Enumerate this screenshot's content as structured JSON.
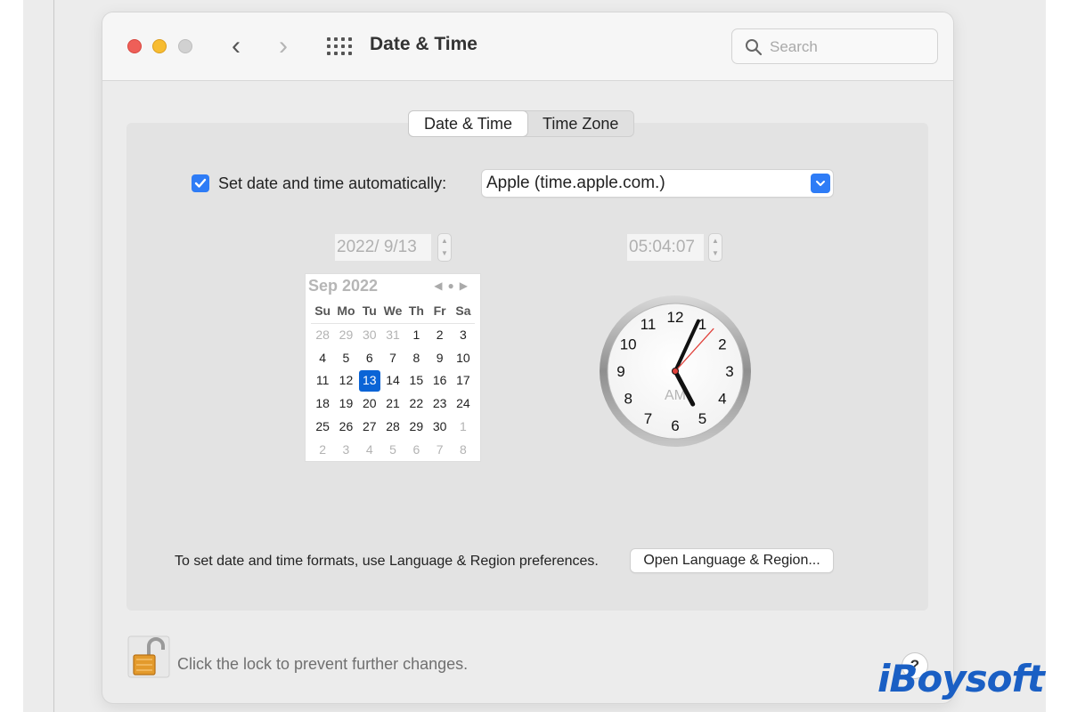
{
  "window": {
    "title": "Date & Time",
    "nav_back": "‹",
    "nav_forward": "›"
  },
  "search": {
    "placeholder": "Search"
  },
  "tabs": [
    {
      "label": "Date & Time",
      "active": true
    },
    {
      "label": "Time Zone",
      "active": false
    }
  ],
  "auto": {
    "label": "Set date and time automatically:",
    "checked": true,
    "server": "Apple (time.apple.com.)"
  },
  "date_field": {
    "value": "2022/  9/13"
  },
  "time_field": {
    "value": "05:04:07"
  },
  "calendar": {
    "month_label": "Sep 2022",
    "weekdays": [
      "Su",
      "Mo",
      "Tu",
      "We",
      "Th",
      "Fr",
      "Sa"
    ],
    "weeks": [
      [
        {
          "d": "28",
          "out": true
        },
        {
          "d": "29",
          "out": true
        },
        {
          "d": "30",
          "out": true
        },
        {
          "d": "31",
          "out": true
        },
        {
          "d": "1"
        },
        {
          "d": "2"
        },
        {
          "d": "3"
        }
      ],
      [
        {
          "d": "4"
        },
        {
          "d": "5"
        },
        {
          "d": "6"
        },
        {
          "d": "7"
        },
        {
          "d": "8"
        },
        {
          "d": "9"
        },
        {
          "d": "10"
        }
      ],
      [
        {
          "d": "11"
        },
        {
          "d": "12"
        },
        {
          "d": "13",
          "selected": true
        },
        {
          "d": "14"
        },
        {
          "d": "15"
        },
        {
          "d": "16"
        },
        {
          "d": "17"
        }
      ],
      [
        {
          "d": "18"
        },
        {
          "d": "19"
        },
        {
          "d": "20"
        },
        {
          "d": "21"
        },
        {
          "d": "22"
        },
        {
          "d": "23"
        },
        {
          "d": "24"
        }
      ],
      [
        {
          "d": "25"
        },
        {
          "d": "26"
        },
        {
          "d": "27"
        },
        {
          "d": "28"
        },
        {
          "d": "29"
        },
        {
          "d": "30"
        },
        {
          "d": "1",
          "out": true
        }
      ],
      [
        {
          "d": "2",
          "out": true
        },
        {
          "d": "3",
          "out": true
        },
        {
          "d": "4",
          "out": true
        },
        {
          "d": "5",
          "out": true
        },
        {
          "d": "6",
          "out": true
        },
        {
          "d": "7",
          "out": true
        },
        {
          "d": "8",
          "out": true
        }
      ]
    ]
  },
  "clock": {
    "numbers": [
      "12",
      "1",
      "2",
      "3",
      "4",
      "5",
      "6",
      "7",
      "8",
      "9",
      "10",
      "11"
    ],
    "period": "AM",
    "hours": 5,
    "minutes": 4,
    "seconds": 7
  },
  "formats": {
    "label": "To set date and time formats, use Language & Region preferences.",
    "button": "Open Language & Region..."
  },
  "footer": {
    "lock_label": "Click the lock to prevent further changes.",
    "help": "?"
  },
  "watermark": "iBoysoft",
  "colors": {
    "accent": "#2e7cf6",
    "selected_day": "#0a64d6",
    "second_hand": "#e0403a"
  },
  "icons": [
    "search-icon",
    "chevron-left-icon",
    "chevron-right-icon",
    "grid-icon",
    "checkmark-icon",
    "chevron-down-icon",
    "lock-icon",
    "help-icon"
  ]
}
